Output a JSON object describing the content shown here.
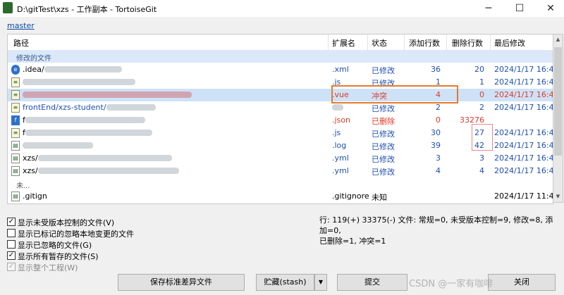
{
  "window": {
    "title": "D:\\gitTest\\xzs - 工作副本 - TortoiseGit",
    "minimize": "─",
    "maximize": "☐",
    "close": "✕"
  },
  "branch": "master",
  "columns": {
    "path": "路径",
    "ext": "扩展名",
    "status": "状态",
    "added": "添加行数",
    "deleted": "删除行数",
    "modified": "最后修改"
  },
  "groups": {
    "modified": "修改的文件",
    "unversioned": "未..."
  },
  "rows": [
    {
      "icon": "blue-icon",
      "path": ".idea/",
      "ext": ".xml",
      "status": "已修改",
      "added": "36",
      "deleted": "20",
      "date": "2024/1/17 16:47"
    },
    {
      "icon": "git-file-icon",
      "path": "",
      "ext": ".js",
      "status": "已修改",
      "added": "1",
      "deleted": "1",
      "date": "2024/1/17 16:47"
    },
    {
      "icon": "git-file-icon",
      "path": "",
      "ext": ".vue",
      "status": "冲突",
      "added": "4",
      "deleted": "0",
      "date": "2024/1/17 16:47"
    },
    {
      "icon": "git-file-icon",
      "path": "frontEnd/xzs-student/",
      "ext": "",
      "status": "已修改",
      "added": "2",
      "deleted": "2",
      "date": "2024/1/17 16:47"
    },
    {
      "icon": "file-icon",
      "path": "f",
      "ext": ".json",
      "status": "已删除",
      "added": "0",
      "deleted": "33276",
      "date": ""
    },
    {
      "icon": "git-file-icon",
      "path": "f",
      "ext": ".js",
      "status": "已修改",
      "added": "30",
      "deleted": "27",
      "date": "2024/1/17 16:47"
    },
    {
      "icon": "file-icon",
      "path": "",
      "ext": ".log",
      "status": "已修改",
      "added": "39",
      "deleted": "42",
      "date": "2024/1/17 16:47"
    },
    {
      "icon": "file-icon",
      "path": "xzs/",
      "ext": ".yml",
      "status": "已修改",
      "added": "3",
      "deleted": "3",
      "date": "2024/1/17 16:47"
    },
    {
      "icon": "file-icon",
      "path": "xzs/",
      "ext": ".yml",
      "status": "已修改",
      "added": "4",
      "deleted": "4",
      "date": "2024/1/17 16:47"
    }
  ],
  "unversioned_row": {
    "path": ".gitign",
    "ext": ".gitignore",
    "status": "未知",
    "date": "2024/1/17 11:44"
  },
  "options": [
    {
      "label": "显示未受版本控制的文件(V)",
      "checked": "✓"
    },
    {
      "label": "显示已标记的忽略本地变更的文件",
      "checked": ""
    },
    {
      "label": "显示已忽略的文件(G)",
      "checked": ""
    },
    {
      "label": "显示所有暂存的文件(S)",
      "checked": "✓"
    },
    {
      "label": "显示整个工程(W)",
      "checked": "✓"
    }
  ],
  "status_line1": "行: 119(+) 33375(-) 文件: 常规=0, 未受版本控制=9, 修改=8, 添加=0,",
  "status_line2": "已删除=1, 冲突=1",
  "buttons": {
    "save_diff": "保存标准差异文件",
    "stash": "贮藏(stash)",
    "stash_arrow": "▼",
    "commit": "提交",
    "close": "关闭"
  },
  "watermark": "CSDN @一家有咖啡"
}
